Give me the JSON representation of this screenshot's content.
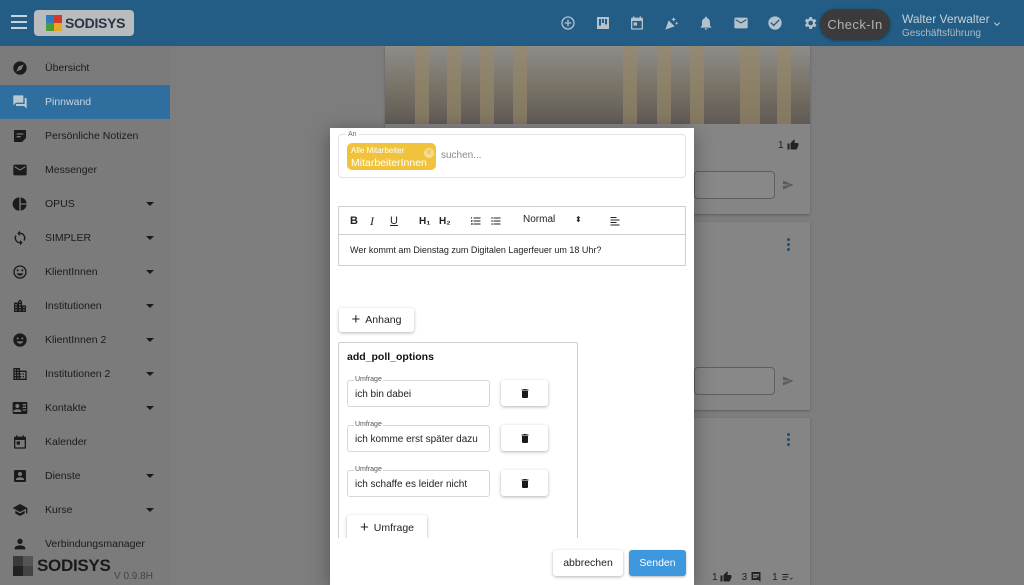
{
  "header": {
    "logo_text": "SODISYS",
    "icons": [
      "add-circle-icon",
      "board-icon",
      "calendar-icon",
      "celebration-icon",
      "bell-icon",
      "mail-icon",
      "check-circle-icon",
      "gear-icon"
    ],
    "checkin_label": "Check-In",
    "user_name": "Walter Verwalter",
    "user_role": "Geschäftsführung"
  },
  "sidebar": {
    "items": [
      {
        "label": "Übersicht",
        "icon": "compass-icon",
        "has_submenu": false,
        "active": false
      },
      {
        "label": "Pinnwand",
        "icon": "forum-icon",
        "has_submenu": false,
        "active": true
      },
      {
        "label": "Persönliche Notizen",
        "icon": "note-icon",
        "has_submenu": false,
        "active": false
      },
      {
        "label": "Messenger",
        "icon": "mail-icon",
        "has_submenu": false,
        "active": false
      },
      {
        "label": "OPUS",
        "icon": "pie-chart-icon",
        "has_submenu": true,
        "active": false
      },
      {
        "label": "SIMPLER",
        "icon": "sync-icon",
        "has_submenu": true,
        "active": false
      },
      {
        "label": "KlientInnen",
        "icon": "smiley-outline-icon",
        "has_submenu": true,
        "active": false
      },
      {
        "label": "Institutionen",
        "icon": "city-icon",
        "has_submenu": true,
        "active": false
      },
      {
        "label": "KlientInnen 2",
        "icon": "smiley-filled-icon",
        "has_submenu": true,
        "active": false
      },
      {
        "label": "Institutionen 2",
        "icon": "building-icon",
        "has_submenu": true,
        "active": false
      },
      {
        "label": "Kontakte",
        "icon": "contact-card-icon",
        "has_submenu": true,
        "active": false
      },
      {
        "label": "Kalender",
        "icon": "calendar-icon",
        "has_submenu": false,
        "active": false
      },
      {
        "label": "Dienste",
        "icon": "badge-icon",
        "has_submenu": true,
        "active": false
      },
      {
        "label": "Kurse",
        "icon": "graduation-cap-icon",
        "has_submenu": true,
        "active": false
      },
      {
        "label": "Verbindungsmanager",
        "icon": "person-icon",
        "has_submenu": false,
        "active": false
      }
    ],
    "footer_logo_text": "SODISYS",
    "version": "V 0.9.8H"
  },
  "background": {
    "card1_likes": "1",
    "card4_likes": "1",
    "card4_comments": "3",
    "card4_polls": "1"
  },
  "modal": {
    "recipients_label": "An",
    "chip_group": "Alle Mitarbeiter",
    "chip_label": "MitarbeiterInnen",
    "search_placeholder": "suchen...",
    "toolbar": {
      "bold": "B",
      "italic": "I",
      "underline": "U",
      "h1": "H₁",
      "h2": "H₂",
      "font_size": "Normal"
    },
    "message_text": "Wer kommt am Dienstag zum Digitalen Lagerfeuer um 18 Uhr?",
    "attachment_button": "Anhang",
    "poll": {
      "title": "add_poll_options",
      "field_label": "Umfrage",
      "options": [
        "ich bin dabei",
        "ich komme erst später dazu",
        "ich schaffe es leider nicht"
      ],
      "add_button": "Umfrage"
    },
    "cancel_button": "abbrechen",
    "send_button": "Senden",
    "accent_color": "#3e98de",
    "chip_color": "#f1c33c"
  }
}
